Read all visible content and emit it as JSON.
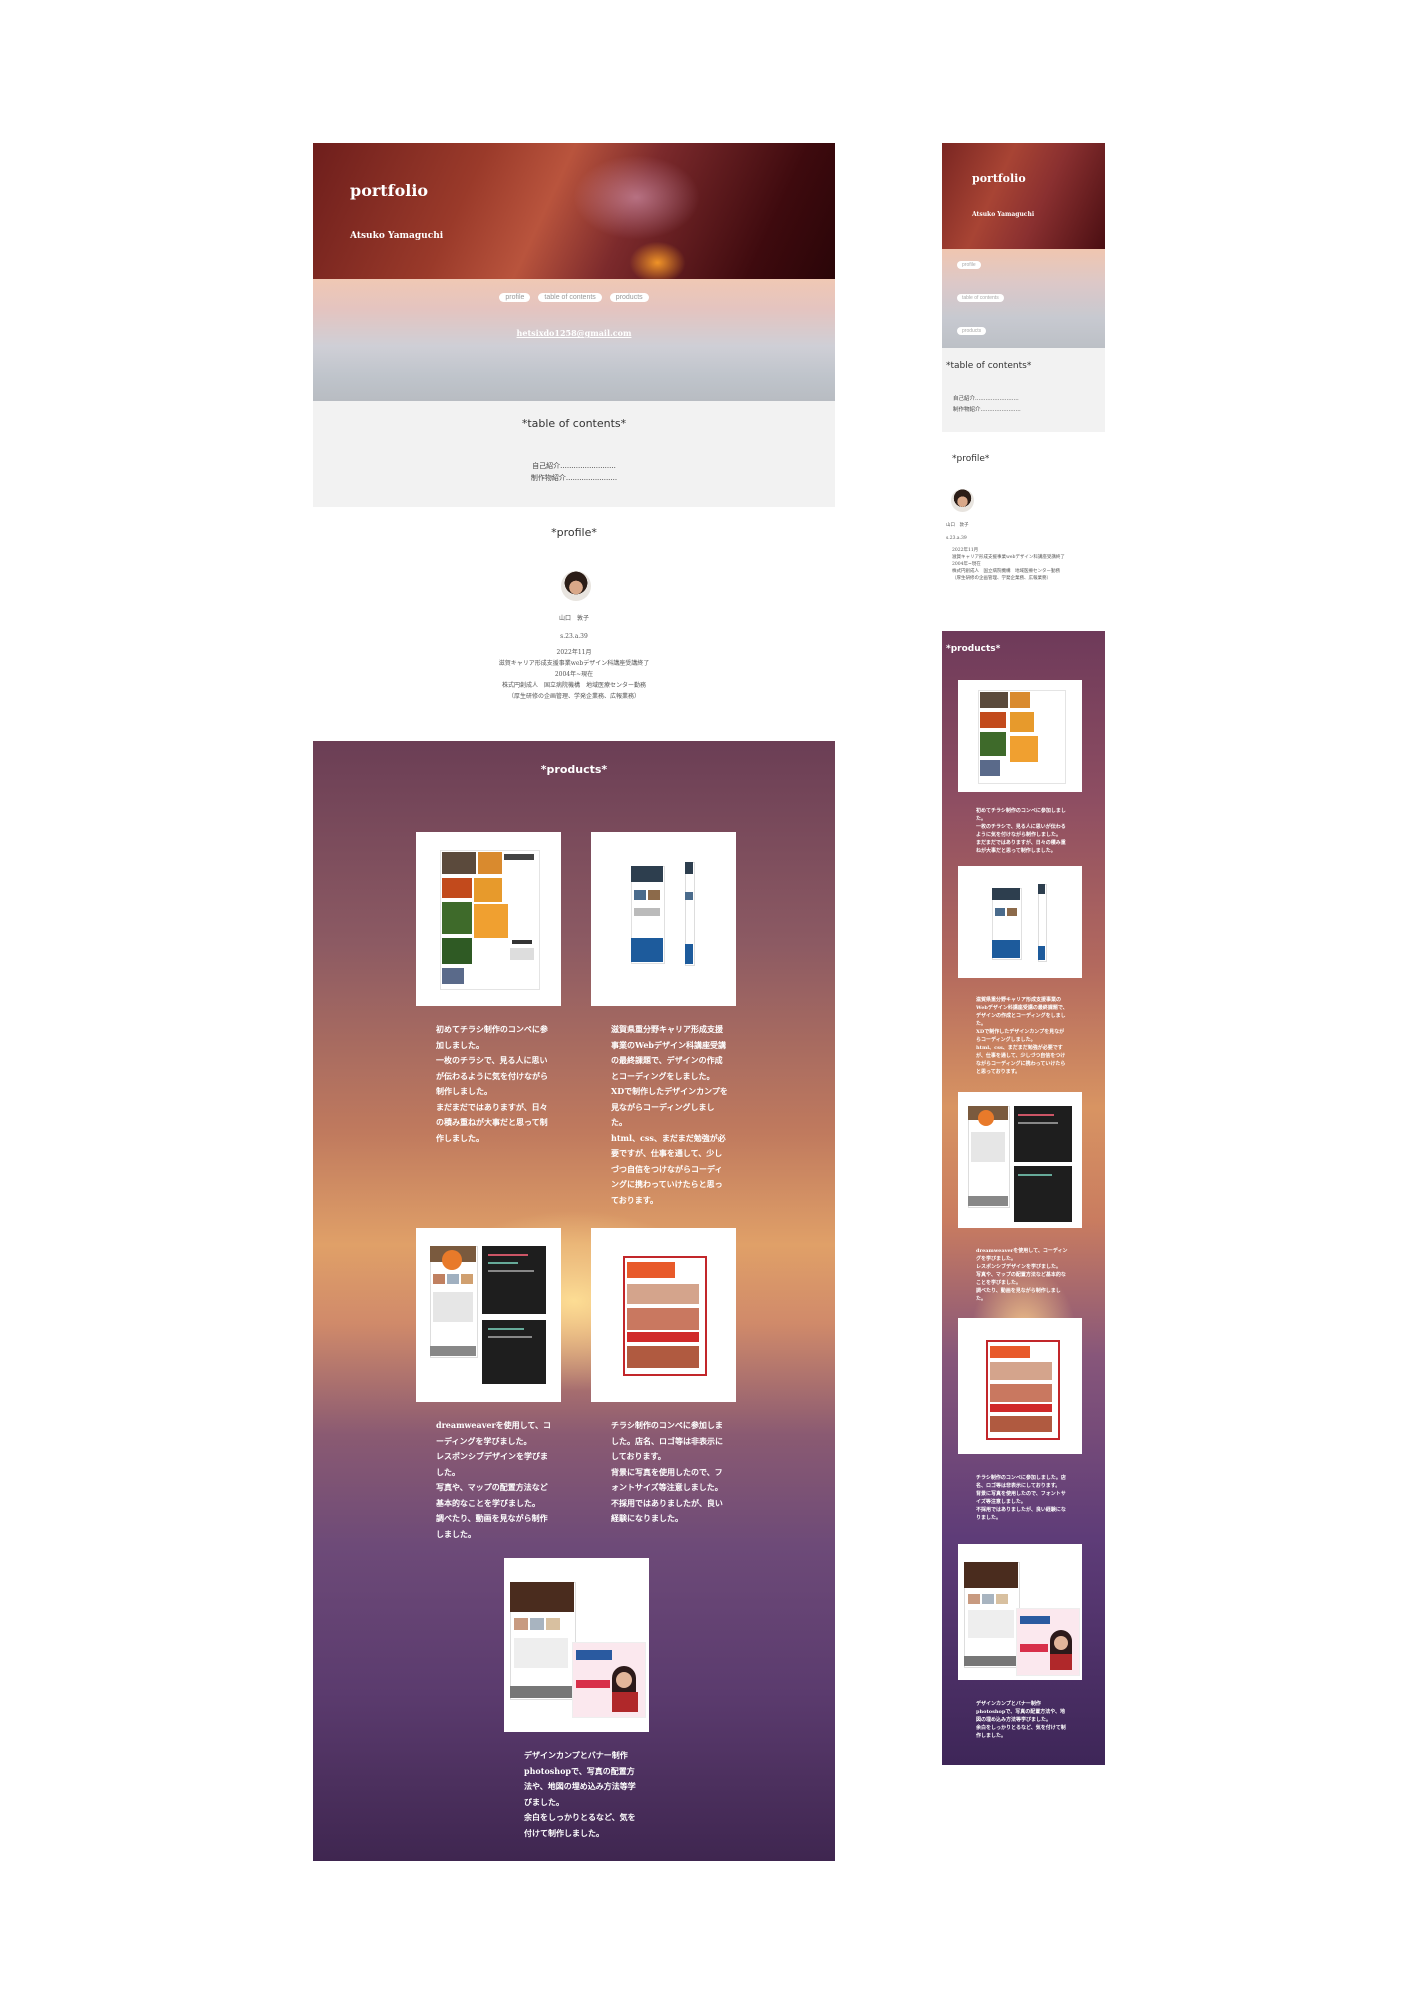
{
  "desktop": {
    "hero": {
      "title": "portfolio",
      "subtitle": "Atsuko Yamaguchi"
    },
    "nav": [
      "profile",
      "table of contents",
      "products"
    ],
    "email": "hetsixdo1258@gmail.com",
    "toc": {
      "title": "*table of contents*",
      "items": [
        "自己紹介.........................",
        "制作物紹介......................."
      ]
    },
    "profile": {
      "title": "*profile*",
      "name": "山口　敦子",
      "handle": "s.23.a.39",
      "lines": [
        "2022年11月",
        "滋賀キャリア形成支援事業webデザイン科講座受講終了",
        "2004年~現在",
        "株式円創成人　国立病院機構　地域医療センター勤務",
        "（厚生研修の企画管理、学発企業務、広報業務）"
      ]
    },
    "products": {
      "title": "*products*",
      "items": [
        {
          "desc": "初めてチラシ制作のコンペに参加しました。\n一枚のチラシで、見る人に思いが伝わるように気を付けながら制作しました。\nまだまだではありますが、日々の積み重ねが大事だと思って制作しました。"
        },
        {
          "desc": "滋賀県重分野キャリア形成支援事業のWebデザイン科講座受講の最終課題で、デザインの作成とコーディングをしました。\nXDで制作したデザインカンプを見ながらコーディングしました。\nhtml、css、まだまだ勉強が必要ですが、仕事を通して、少しづつ自信をつけながらコーディングに携わっていけたらと思っております。"
        },
        {
          "desc": "dreamweaverを使用して、コーディングを学びました。\nレスポンシブデザインを学びました。\n写真や、マップの配置方法など基本的なことを学びました。\n調べたり、動画を見ながら制作しました。"
        },
        {
          "desc": "チラシ制作のコンペに参加しました。店名、ロゴ等は非表示にしております。\n背景に写真を使用したので、フォントサイズ等注意しました。\n不採用ではありましたが、良い経験になりました。"
        },
        {
          "desc": "デザインカンプとバナー制作\nphotoshopで、写真の配置方法や、地図の埋め込み方法等学びました。\n余白をしっかりとるなど、気を付けて制作しました。"
        }
      ]
    }
  },
  "mobile": {
    "hero": {
      "title": "portfolio",
      "subtitle": "Atsuko Yamaguchi"
    },
    "nav": [
      "profile",
      "table of contents",
      "products"
    ],
    "toc": {
      "title": "*table of contents*",
      "items": [
        "自己紹介.........................",
        "制作物紹介......................."
      ]
    },
    "profile": {
      "title": "*profile*",
      "name": "山口　敦子",
      "handle": "s.23.a.39",
      "lines": [
        "2022年11月",
        "滋賀キャリア形成支援事業webデザイン科講座受講終了",
        "2004年~現在",
        "株式円創成人　国立病院機構　地域医療センター勤務",
        "（厚生研修の企画管理、学発企業務、広報業務）"
      ]
    },
    "products": {
      "title": "*products*",
      "items": [
        {
          "desc": "初めてチラシ制作のコンペに参加しました。\n一枚のチラシで、見る人に思いが伝わるように気を付けながら制作しました。\nまだまだではありますが、日々の積み重ねが大事だと思って制作しました。"
        },
        {
          "desc": "滋賀県重分野キャリア形成支援事業のWebデザイン科講座受講の最終課題で、デザインの作成とコーディングをしました。\nXDで制作したデザインカンプを見ながらコーディングしました。\nhtml、css、まだまだ勉強が必要ですが、仕事を通して、少しづつ自信をつけながらコーディングに携わっていけたらと思っております。"
        },
        {
          "desc": "dreamweaverを使用して、コーディングを学びました。\nレスポンシブデザインを学びました。\n写真や、マップの配置方法など基本的なことを学びました。\n調べたり、動画を見ながら制作しました。"
        },
        {
          "desc": "チラシ制作のコンペに参加しました。店名、ロゴ等は非表示にしております。\n背景に写真を使用したので、フォントサイズ等注意しました。\n不採用ではありましたが、良い経験になりました。"
        },
        {
          "desc": "デザインカンプとバナー制作\nphotoshopで、写真の配置方法や、地図の埋め込み方法等学びました。\n余白をしっかりとるなど、気を付けて制作しました。"
        }
      ]
    }
  }
}
